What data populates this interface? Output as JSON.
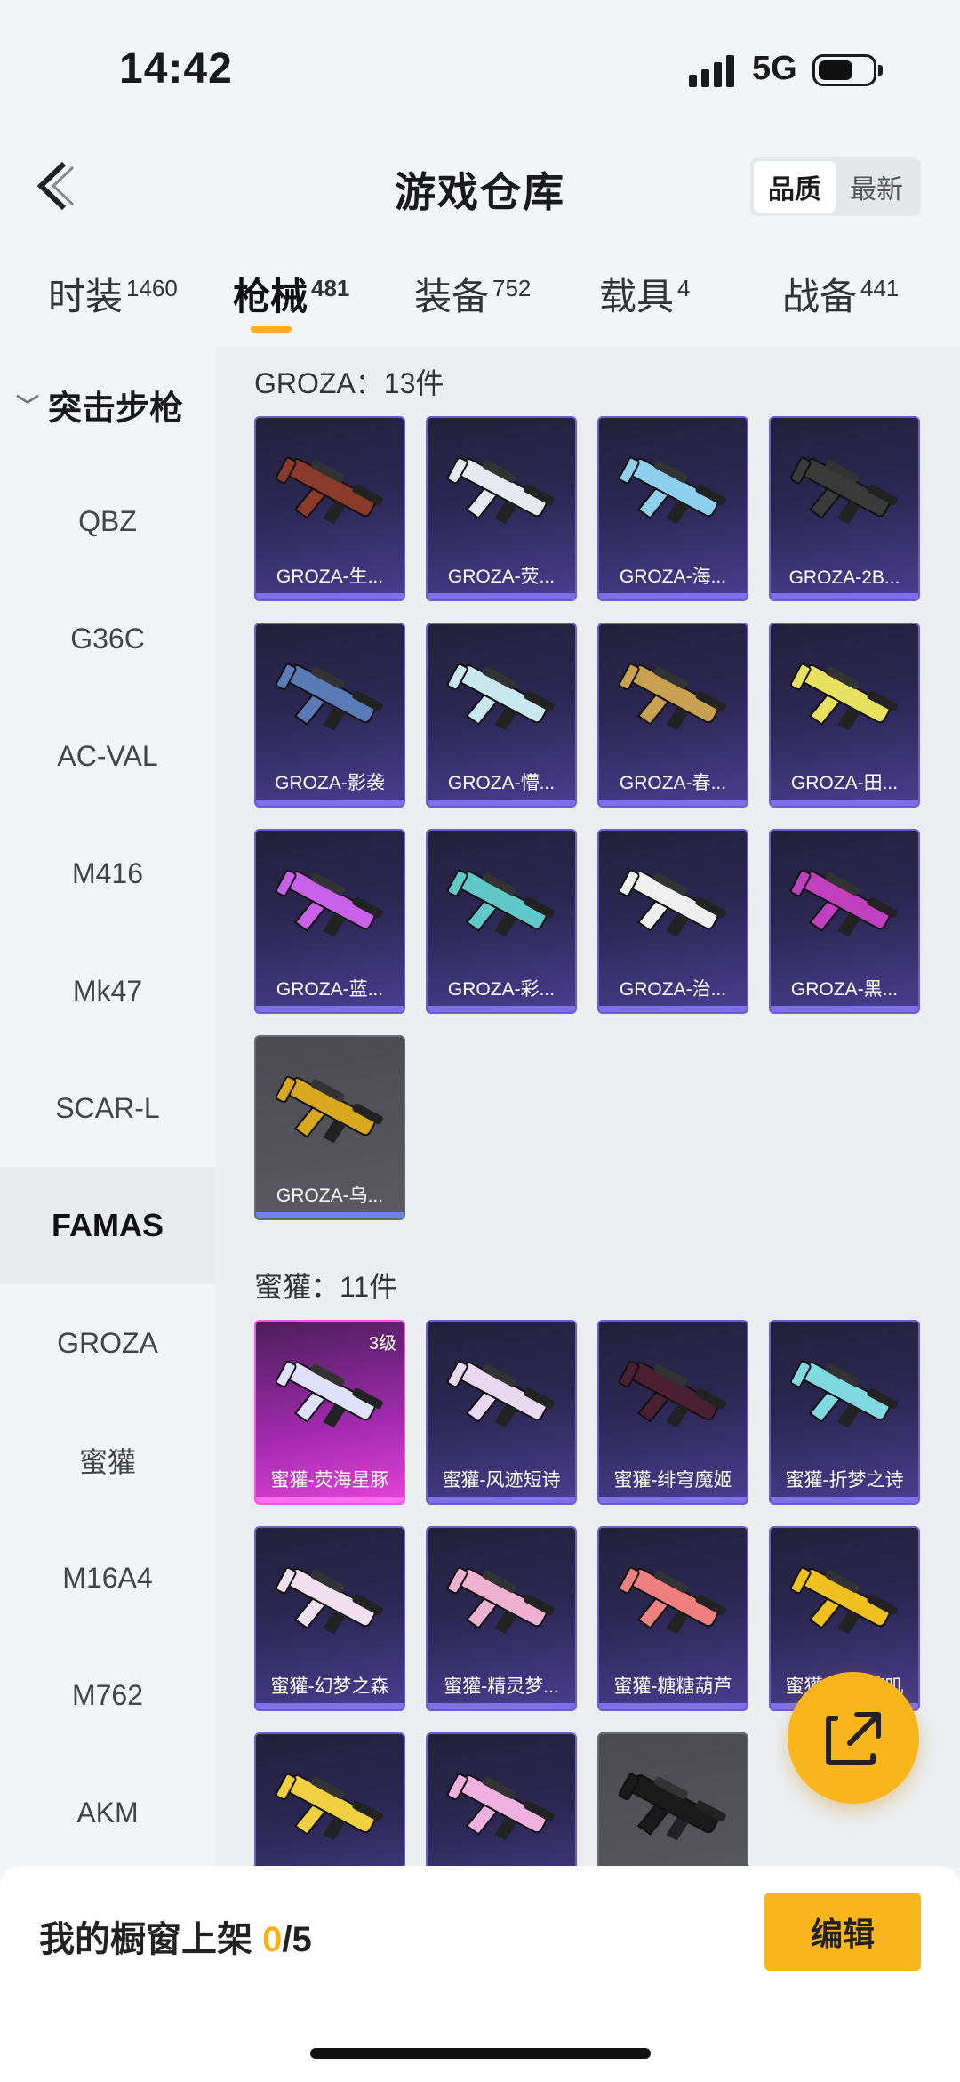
{
  "status_bar": {
    "time": "14:42",
    "network": "5G"
  },
  "header": {
    "title": "游戏仓库",
    "sort_options": [
      "品质",
      "最新"
    ],
    "sort_active": "品质"
  },
  "tabs": [
    {
      "label": "时装",
      "count": "1460"
    },
    {
      "label": "枪械",
      "count": "481"
    },
    {
      "label": "装备",
      "count": "752"
    },
    {
      "label": "载具",
      "count": "4"
    },
    {
      "label": "战备",
      "count": "441"
    }
  ],
  "active_tab": "枪械",
  "sidebar": {
    "group": "突击步枪",
    "items": [
      "QBZ",
      "G36C",
      "AC-VAL",
      "M416",
      "Mk47",
      "SCAR-L",
      "FAMAS",
      "GROZA",
      "蜜獾",
      "M16A4",
      "M762",
      "AKM"
    ],
    "active": "FAMAS"
  },
  "sections": [
    {
      "title": "GROZA：13件",
      "items": [
        {
          "name": "GROZA-生...",
          "rarity": "purple"
        },
        {
          "name": "GROZA-荧...",
          "rarity": "purple"
        },
        {
          "name": "GROZA-海...",
          "rarity": "purple"
        },
        {
          "name": "GROZA-2B...",
          "rarity": "purple"
        },
        {
          "name": "GROZA-影袭",
          "rarity": "purple"
        },
        {
          "name": "GROZA-懵...",
          "rarity": "purple"
        },
        {
          "name": "GROZA-春...",
          "rarity": "purple"
        },
        {
          "name": "GROZA-田...",
          "rarity": "purple"
        },
        {
          "name": "GROZA-蓝...",
          "rarity": "purple"
        },
        {
          "name": "GROZA-彩...",
          "rarity": "purple"
        },
        {
          "name": "GROZA-治...",
          "rarity": "purple"
        },
        {
          "name": "GROZA-黑...",
          "rarity": "purple"
        },
        {
          "name": "GROZA-乌...",
          "rarity": "gray"
        }
      ]
    },
    {
      "title": "蜜獾：11件",
      "items": [
        {
          "name": "蜜獾-荧海星豚",
          "rarity": "pink",
          "level": "3级"
        },
        {
          "name": "蜜獾-风迹短诗",
          "rarity": "purple"
        },
        {
          "name": "蜜獾-绯穹魔姬",
          "rarity": "purple"
        },
        {
          "name": "蜜獾-折梦之诗",
          "rarity": "purple"
        },
        {
          "name": "蜜獾-幻梦之森",
          "rarity": "purple"
        },
        {
          "name": "蜜獾-精灵梦...",
          "rarity": "purple"
        },
        {
          "name": "蜜獾-糖糖葫芦",
          "rarity": "purple"
        },
        {
          "name": "蜜獾-天降萌叽",
          "rarity": "purple"
        },
        {
          "name": "",
          "rarity": "purple"
        },
        {
          "name": "",
          "rarity": "purple"
        },
        {
          "name": "",
          "rarity": "gray"
        }
      ]
    }
  ],
  "gun_colors": [
    "#8a3a2a",
    "#e8e8f0",
    "#8ecff0",
    "#3a3a3a",
    "#5a7ab8",
    "#c8e8f0",
    "#c8a050",
    "#e8e060",
    "#c860e8",
    "#60c8c8",
    "#f0f0f0",
    "#c040c0",
    "#d8a820",
    "#e0e0ff",
    "#e8d8f0",
    "#4a2030",
    "#80d8e0",
    "#f0e0f0",
    "#f0b0d0",
    "#f08080",
    "#f0c020",
    "#f0d040",
    "#f0b0e0",
    "#1a1a1a"
  ],
  "bottom": {
    "showcase_label": "我的橱窗上架",
    "current": "0",
    "total": "/5",
    "edit_label": "编辑"
  }
}
